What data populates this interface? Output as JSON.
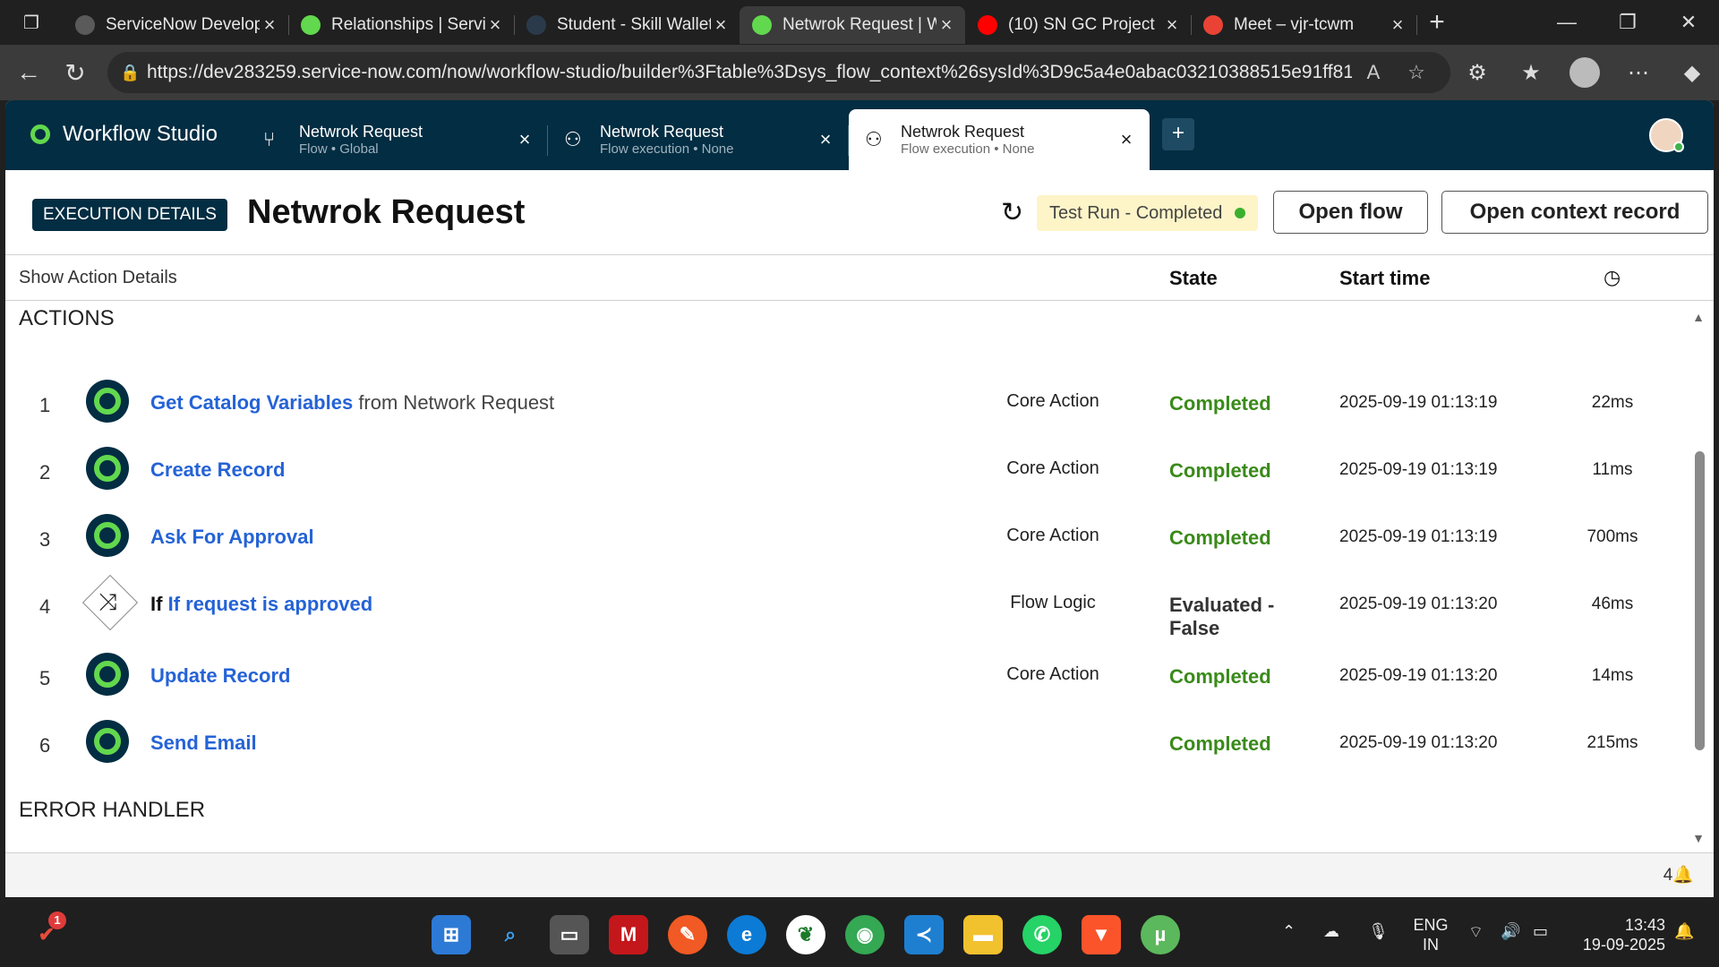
{
  "browser": {
    "tabs": [
      {
        "title": "ServiceNow Developer",
        "favicon_color": "#5a5a5a",
        "active": false
      },
      {
        "title": "Relationships | ServiceNow",
        "favicon_color": "#62d84e",
        "active": false
      },
      {
        "title": "Student - Skill Wallet",
        "favicon_color": "#2a3a4a",
        "active": false
      },
      {
        "title": "Netwrok Request | Workflow",
        "favicon_color": "#62d84e",
        "active": true
      },
      {
        "title": "(10) SN GC Project",
        "favicon_color": "#ff0000",
        "active": false
      },
      {
        "title": "Meet – vjr-tcwm",
        "favicon_color": "#ea4335",
        "active": false
      }
    ],
    "url": "https://dev283259.service-now.com/now/workflow-studio/builder%3Ftable%3Dsys_flow_context%26sysId%3D9c5a4e0abac03210388515e91ff81..."
  },
  "app": {
    "name": "Workflow Studio",
    "tabs": [
      {
        "title": "Netwrok Request",
        "subtitle": "Flow • Global",
        "icon": "flow-icon"
      },
      {
        "title": "Netwrok Request",
        "subtitle": "Flow execution • None",
        "icon": "execution-icon"
      },
      {
        "title": "Netwrok Request",
        "subtitle": "Flow execution • None",
        "icon": "execution-icon"
      }
    ]
  },
  "execution": {
    "badge": "EXECUTION DETAILS",
    "title": "Netwrok Request",
    "status": "Test Run - Completed",
    "status_color": "#3ab02e",
    "open_flow_label": "Open flow",
    "open_context_label": "Open context record"
  },
  "table": {
    "show_details_label": "Show Action Details",
    "col_state": "State",
    "col_start": "Start time",
    "actions_heading": "ACTIONS",
    "error_heading": "ERROR HANDLER",
    "rows": [
      {
        "num": "1",
        "link": "Get Catalog Variables",
        "rest": " from Network Request",
        "type": "Core Action",
        "state": "Completed",
        "start": "2025-09-19 01:13:19",
        "duration": "22ms"
      },
      {
        "num": "2",
        "link": "Create Record",
        "rest": "",
        "type": "Core Action",
        "state": "Completed",
        "start": "2025-09-19 01:13:19",
        "duration": "11ms"
      },
      {
        "num": "3",
        "link": "Ask For Approval",
        "rest": "",
        "type": "Core Action",
        "state": "Completed",
        "start": "2025-09-19 01:13:19",
        "duration": "700ms"
      },
      {
        "num": "4",
        "keyword": "If",
        "link": "If request is approved",
        "rest": "",
        "type": "Flow Logic",
        "state": "Evaluated - False",
        "start": "2025-09-19 01:13:20",
        "duration": "46ms"
      },
      {
        "num": "5",
        "link": "Update Record",
        "rest": "",
        "type": "Core Action",
        "state": "Completed",
        "start": "2025-09-19 01:13:20",
        "duration": "14ms"
      },
      {
        "num": "6",
        "link": "Send Email",
        "rest": "",
        "type": "",
        "state": "Completed",
        "start": "2025-09-19 01:13:20",
        "duration": "215ms"
      }
    ]
  },
  "footer": {
    "notifications": "4"
  },
  "taskbar": {
    "lang": "ENG",
    "region": "IN",
    "time": "13:43",
    "date": "19-09-2025",
    "badge": "1"
  }
}
